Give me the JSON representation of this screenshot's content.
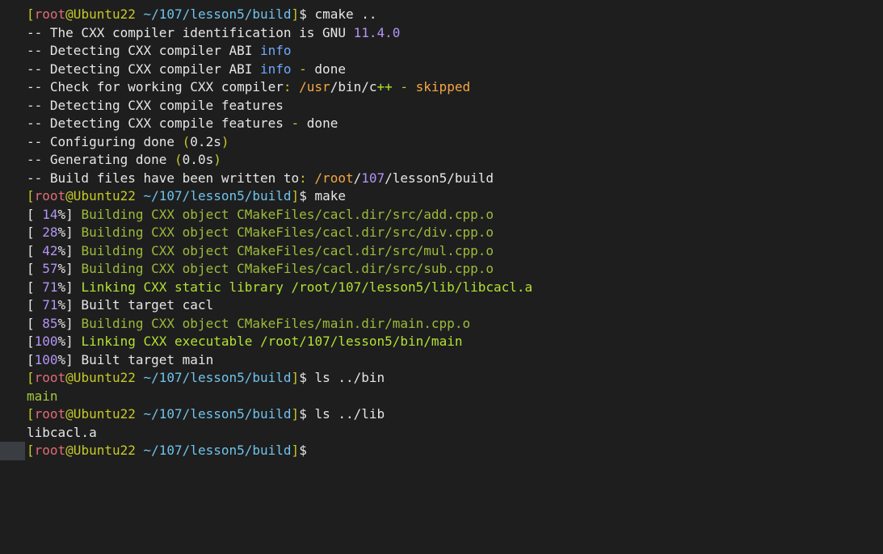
{
  "colors": {
    "background": "#1e1e1e",
    "default": "#e6e6e6",
    "bracket": "#c6c928",
    "user": "#e06c75",
    "host": "#c6c928",
    "path": "#6fc3ec",
    "version": "#b294f5",
    "info": "#6ea8fe",
    "orange": "#f5a742",
    "green": "#a6c83b",
    "bright_green": "#b4e232",
    "percent": "#b294f5"
  },
  "terminal": {
    "lines": [
      [
        [
          "c-bracket",
          "["
        ],
        [
          "c-user",
          "root"
        ],
        [
          "c-host",
          "@Ubuntu22"
        ],
        [
          "c-default",
          " "
        ],
        [
          "c-path",
          "~/107/lesson5/build"
        ],
        [
          "c-bracket",
          "]"
        ],
        [
          "c-default",
          "$ cmake .."
        ]
      ],
      [
        [
          "c-default",
          "-- The CXX compiler identification is GNU "
        ],
        [
          "c-version",
          "11.4.0"
        ]
      ],
      [
        [
          "c-default",
          "-- Detecting CXX compiler ABI "
        ],
        [
          "c-info",
          "info"
        ]
      ],
      [
        [
          "c-default",
          "-- Detecting CXX compiler ABI "
        ],
        [
          "c-info",
          "info"
        ],
        [
          "c-dim",
          " - "
        ],
        [
          "c-default",
          "done"
        ]
      ],
      [
        [
          "c-default",
          "-- Check for working CXX compiler"
        ],
        [
          "c-dim",
          ": "
        ],
        [
          "c-orange",
          "/usr"
        ],
        [
          "c-default",
          "/bin/c"
        ],
        [
          "c-bright-green",
          "++"
        ],
        [
          "c-dim",
          " - "
        ],
        [
          "c-orange",
          "skipped"
        ]
      ],
      [
        [
          "c-default",
          "-- Detecting CXX compile features"
        ]
      ],
      [
        [
          "c-default",
          "-- Detecting CXX compile features"
        ],
        [
          "c-dim",
          " - "
        ],
        [
          "c-default",
          "done"
        ]
      ],
      [
        [
          "c-default",
          "-- Configuring done "
        ],
        [
          "c-dim",
          "("
        ],
        [
          "c-default",
          "0.2s"
        ],
        [
          "c-dim",
          ")"
        ]
      ],
      [
        [
          "c-default",
          "-- Generating done "
        ],
        [
          "c-dim",
          "("
        ],
        [
          "c-default",
          "0.0s"
        ],
        [
          "c-dim",
          ")"
        ]
      ],
      [
        [
          "c-default",
          "-- Build files have been written to"
        ],
        [
          "c-dim",
          ": "
        ],
        [
          "c-orange",
          "/root"
        ],
        [
          "c-default",
          "/"
        ],
        [
          "c-version",
          "107"
        ],
        [
          "c-default",
          "/lesson5/build"
        ]
      ],
      [
        [
          "c-bracket",
          "["
        ],
        [
          "c-user",
          "root"
        ],
        [
          "c-host",
          "@Ubuntu22"
        ],
        [
          "c-default",
          " "
        ],
        [
          "c-path",
          "~/107/lesson5/build"
        ],
        [
          "c-bracket",
          "]"
        ],
        [
          "c-default",
          "$ make"
        ]
      ],
      [
        [
          "c-default",
          "[ "
        ],
        [
          "c-pct",
          "14"
        ],
        [
          "c-default",
          "%] "
        ],
        [
          "c-olive",
          "Building CXX object CMakeFiles/cacl.dir/src/add.cpp.o"
        ]
      ],
      [
        [
          "c-default",
          "[ "
        ],
        [
          "c-pct",
          "28"
        ],
        [
          "c-default",
          "%] "
        ],
        [
          "c-olive",
          "Building CXX object CMakeFiles/cacl.dir/src/div.cpp.o"
        ]
      ],
      [
        [
          "c-default",
          "[ "
        ],
        [
          "c-pct",
          "42"
        ],
        [
          "c-default",
          "%] "
        ],
        [
          "c-olive",
          "Building CXX object CMakeFiles/cacl.dir/src/mul.cpp.o"
        ]
      ],
      [
        [
          "c-default",
          "[ "
        ],
        [
          "c-pct",
          "57"
        ],
        [
          "c-default",
          "%] "
        ],
        [
          "c-olive",
          "Building CXX object CMakeFiles/cacl.dir/src/sub.cpp.o"
        ]
      ],
      [
        [
          "c-default",
          "[ "
        ],
        [
          "c-pct",
          "71"
        ],
        [
          "c-default",
          "%] "
        ],
        [
          "c-bright-green",
          "Linking CXX static library /root/107/lesson5/lib/libcacl.a"
        ]
      ],
      [
        [
          "c-default",
          "[ "
        ],
        [
          "c-pct",
          "71"
        ],
        [
          "c-default",
          "%] Built target cacl"
        ]
      ],
      [
        [
          "c-default",
          "[ "
        ],
        [
          "c-pct",
          "85"
        ],
        [
          "c-default",
          "%] "
        ],
        [
          "c-olive",
          "Building CXX object CMakeFiles/main.dir/main.cpp.o"
        ]
      ],
      [
        [
          "c-default",
          "["
        ],
        [
          "c-pct",
          "100"
        ],
        [
          "c-default",
          "%] "
        ],
        [
          "c-bright-green",
          "Linking CXX executable /root/107/lesson5/bin/main"
        ]
      ],
      [
        [
          "c-default",
          "["
        ],
        [
          "c-pct",
          "100"
        ],
        [
          "c-default",
          "%] Built target main"
        ]
      ],
      [
        [
          "c-bracket",
          "["
        ],
        [
          "c-user",
          "root"
        ],
        [
          "c-host",
          "@Ubuntu22"
        ],
        [
          "c-default",
          " "
        ],
        [
          "c-path",
          "~/107/lesson5/build"
        ],
        [
          "c-bracket",
          "]"
        ],
        [
          "c-default",
          "$ ls ../bin"
        ]
      ],
      [
        [
          "c-green",
          "main"
        ]
      ],
      [
        [
          "c-bracket",
          "["
        ],
        [
          "c-user",
          "root"
        ],
        [
          "c-host",
          "@Ubuntu22"
        ],
        [
          "c-default",
          " "
        ],
        [
          "c-path",
          "~/107/lesson5/build"
        ],
        [
          "c-bracket",
          "]"
        ],
        [
          "c-default",
          "$ ls ../lib"
        ]
      ],
      [
        [
          "c-default",
          "libcacl.a"
        ]
      ],
      [
        [
          "c-bracket",
          "["
        ],
        [
          "c-user",
          "root"
        ],
        [
          "c-host",
          "@Ubuntu22"
        ],
        [
          "c-default",
          " "
        ],
        [
          "c-path",
          "~/107/lesson5/build"
        ],
        [
          "c-bracket",
          "]"
        ],
        [
          "c-default",
          "$"
        ]
      ]
    ]
  }
}
